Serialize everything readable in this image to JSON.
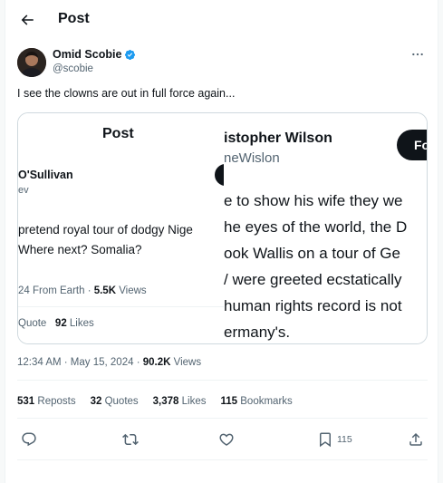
{
  "header": {
    "title": "Post"
  },
  "author": {
    "name": "Omid Scobie",
    "handle": "@scobie"
  },
  "tweet": {
    "text": "I see the clowns are out in full force again..."
  },
  "embedded": {
    "left": {
      "title": "Post",
      "name": "O'Sullivan",
      "handle": "ev",
      "line1": "pretend royal tour of dodgy Nige",
      "line2": "Where next? Somalia?",
      "meta_prefix": "24 From Earth · ",
      "views_count": "5.5K",
      "views_label": " Views",
      "quote_label": "Quote",
      "likes_count": "92",
      "likes_label": " Likes"
    },
    "right": {
      "name": "istopher Wilson",
      "handle": "neWislon",
      "follow_label": "Fo",
      "lines": [
        "e to show his wife they we",
        "he eyes of the world, the D",
        "ook Wallis on a tour of Ge",
        "/ were greeted ecstatically",
        "human rights record is not",
        "ermany's."
      ]
    }
  },
  "timestamp": {
    "time": "12:34 AM · May 15, 2024 · ",
    "views_count": "90.2K",
    "views_label": " Views"
  },
  "stats": [
    {
      "count": "531",
      "label": "Reposts"
    },
    {
      "count": "32",
      "label": "Quotes"
    },
    {
      "count": "3,378",
      "label": "Likes"
    },
    {
      "count": "115",
      "label": "Bookmarks"
    }
  ],
  "actions": {
    "bookmark_count": "115"
  },
  "icons": [
    "back-arrow-icon",
    "verified-badge-icon",
    "more-icon",
    "reply-icon",
    "repost-icon",
    "like-icon",
    "bookmark-icon",
    "share-icon"
  ],
  "colors": {
    "verified": "#1d9bf0",
    "text": "#0f1419",
    "muted": "#536471"
  }
}
